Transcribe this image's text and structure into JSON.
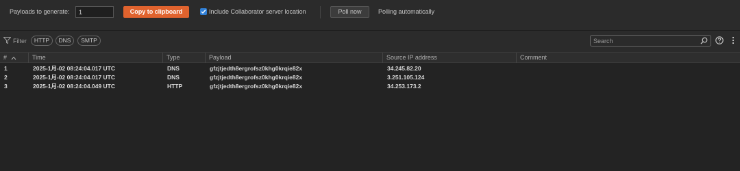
{
  "toolbar": {
    "payloads_label": "Payloads to generate:",
    "payloads_value": "1",
    "copy_button": "Copy to clipboard",
    "include_label": "Include Collaborator server location",
    "include_checked": true,
    "poll_button": "Poll now",
    "polling_status": "Polling automatically"
  },
  "filter": {
    "label": "Filter",
    "pills": [
      "HTTP",
      "DNS",
      "SMTP"
    ],
    "search_placeholder": "Search"
  },
  "table": {
    "columns": [
      "#",
      "Time",
      "Type",
      "Payload",
      "Source IP address",
      "Comment"
    ],
    "rows": [
      {
        "num": "1",
        "time": "2025-1月-02 08:24:04.017 UTC",
        "type": "DNS",
        "payload": "gfzjtjedth8ergrofsz0khg0krqie82x",
        "ip": "34.245.82.20",
        "comment": ""
      },
      {
        "num": "2",
        "time": "2025-1月-02 08:24:04.017 UTC",
        "type": "DNS",
        "payload": "gfzjtjedth8ergrofsz0khg0krqie82x",
        "ip": "3.251.105.124",
        "comment": ""
      },
      {
        "num": "3",
        "time": "2025-1月-02 08:24:04.049 UTC",
        "type": "HTTP",
        "payload": "gfzjtjedth8ergrofsz0khg0krqie82x",
        "ip": "34.253.173.2",
        "comment": ""
      }
    ]
  },
  "colors": {
    "accent": "#e0632e",
    "checkbox": "#2f7fd6",
    "background": "#2b2b2b"
  },
  "icons": [
    "filter-icon",
    "search-icon",
    "help-icon",
    "kebab-menu-icon",
    "sort-ascending-icon",
    "checkmark-icon"
  ]
}
